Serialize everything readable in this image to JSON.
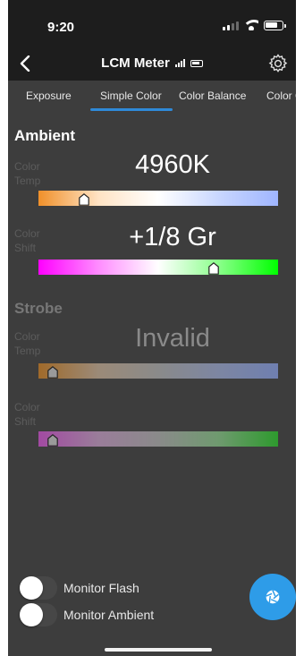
{
  "status_bar": {
    "time": "9:20",
    "icons": [
      "cellular-signal-icon",
      "wifi-icon",
      "battery-icon"
    ]
  },
  "nav": {
    "back_icon": "chevron-left-icon",
    "title": "LCM Meter",
    "title_icons": [
      "meter-signal-icon",
      "meter-battery-icon"
    ],
    "settings_icon": "gear-icon"
  },
  "tabs": [
    {
      "label": "Exposure",
      "active": false
    },
    {
      "label": "Simple Color",
      "active": true
    },
    {
      "label": "Color Balance",
      "active": false
    },
    {
      "label": "Color Gr",
      "active": false
    }
  ],
  "ambient": {
    "title": "Ambient",
    "color_temp": {
      "label_line1": "Color",
      "label_line2": "Temp",
      "value": "4960K",
      "slider_position": 0.19,
      "gradient": [
        "#f0902a",
        "#ffe3c4",
        "#ffffff",
        "#c9d7ff",
        "#9fb5ff"
      ]
    },
    "color_shift": {
      "label_line1": "Color",
      "label_line2": "Shift",
      "value": "+1/8 Gr",
      "slider_position": 0.73,
      "gradient": [
        "#ff00ff",
        "#ff8cff",
        "#ffffff",
        "#8cff8c",
        "#00ff00"
      ]
    }
  },
  "strobe": {
    "title": "Strobe",
    "color_temp": {
      "label_line1": "Color",
      "label_line2": "Temp",
      "value": "Invalid",
      "slider_position": 0.06,
      "gradient": [
        "#a06a2a",
        "#9b8a78",
        "#8a8a8a",
        "#7d86a2",
        "#6f7fb0"
      ]
    },
    "color_shift": {
      "label_line1": "Color",
      "label_line2": "Shift",
      "value": "",
      "slider_position": 0.06,
      "gradient": [
        "#a24aa2",
        "#9a7d9a",
        "#8a8a8a",
        "#6f9a6f",
        "#2e9a2e"
      ]
    }
  },
  "toggles": [
    {
      "label": "Monitor Flash",
      "on": false
    },
    {
      "label": "Monitor Ambient",
      "on": false
    }
  ],
  "fab": {
    "icon": "shutter-aperture-icon"
  },
  "colors": {
    "background": "#3d3d3d",
    "header": "#1d1d1d",
    "accent": "#2e9ce8",
    "tab_underline": "#2f8ad8",
    "inactive_text": "#9a9a9a"
  }
}
